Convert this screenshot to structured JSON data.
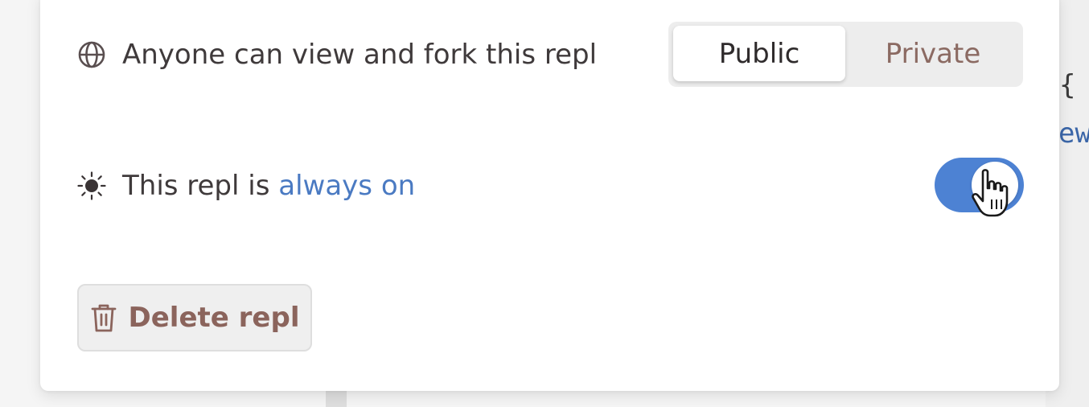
{
  "colors": {
    "accent_link": "#4a7ac2",
    "toggle_on": "#4d82d3",
    "danger_text": "#8b645c",
    "private_text": "#8b6a62"
  },
  "background": {
    "code_brace": "{",
    "code_fragment": "ew"
  },
  "visibility": {
    "icon": "globe-icon",
    "label": "Anyone can view and fork this repl",
    "options": [
      {
        "label": "Public",
        "selected": true
      },
      {
        "label": "Private",
        "selected": false
      }
    ]
  },
  "always_on": {
    "icon": "sun-icon",
    "label_prefix": "This repl is ",
    "label_link": "always on",
    "enabled": true,
    "cursor_icon": "pointer-hand-icon"
  },
  "delete": {
    "icon": "trash-icon",
    "label": "Delete repl"
  }
}
